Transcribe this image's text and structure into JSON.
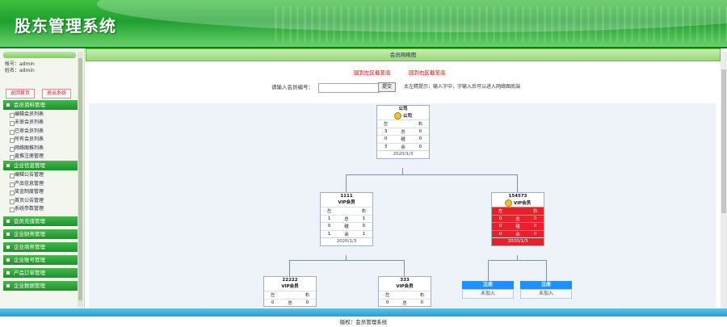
{
  "app": {
    "title": "股东管理系统"
  },
  "user": {
    "account": "帐号：admin",
    "name": "姓名：admin"
  },
  "sidebar_buttons": {
    "home": "返回首页",
    "logout": "退出系统"
  },
  "menu": {
    "c1": "会员资料管理",
    "c1_items": [
      "编辑会员列表",
      "未审会员列表",
      "已审会员列表",
      "所有会员列表",
      "网络图推列表",
      "直推注册管理"
    ],
    "c2": "企业信息管理",
    "c2_items": [
      "编辑公告管理",
      "产品信息管理",
      "奖金制度管理",
      "首页公告管理",
      "系统参数管理"
    ],
    "c3": "会员充值管理",
    "c4": "企业财务管理",
    "c5": "企业商务管理",
    "c6": "企业账号管理",
    "c7": "产品订单管理",
    "c8": "企业数据管理"
  },
  "main": {
    "header": "会员网络图",
    "link_left": "回到左区截至底",
    "link_right": "回到右区截至底",
    "search_label": "请输入会员编号：",
    "search_value": "",
    "search_button": "提交",
    "tip": "太左精提示：输入字中，字输入后可以进入网络图底端"
  },
  "tree": {
    "root": {
      "id": "公司",
      "level": "公司",
      "left": "左",
      "right": "右",
      "rows": [
        [
          "3",
          "总",
          "0"
        ],
        [
          "0",
          "碰",
          "0"
        ],
        [
          "3",
          "余",
          "0"
        ]
      ],
      "date": "2020/1/3"
    },
    "n1111": {
      "id": "1111",
      "level": "VIP会员",
      "left": "左",
      "right": "右",
      "rows": [
        [
          "1",
          "总",
          "1"
        ],
        [
          "0",
          "碰",
          "0"
        ],
        [
          "1",
          "余",
          "1"
        ]
      ],
      "date": "2020/1/3"
    },
    "n154573": {
      "id": "154573",
      "level": "VIP会员",
      "left": "左",
      "right": "右",
      "rows": [
        [
          "0",
          "总",
          "0"
        ],
        [
          "0",
          "碰",
          "0"
        ],
        [
          "0",
          "余",
          "0"
        ]
      ],
      "date": "2020/1/3"
    },
    "n22222": {
      "id": "22222",
      "level": "VIP会员",
      "left": "左",
      "right": "右",
      "rows": [
        [
          "0",
          "总",
          "0"
        ]
      ]
    },
    "n333": {
      "id": "333",
      "level": "VIP会员",
      "left": "左",
      "right": "右",
      "rows": [
        [
          "0",
          "总",
          "0"
        ]
      ]
    },
    "reg": {
      "title": "注册",
      "status": "未加入"
    }
  },
  "footer": "版权：会员管理系统"
}
